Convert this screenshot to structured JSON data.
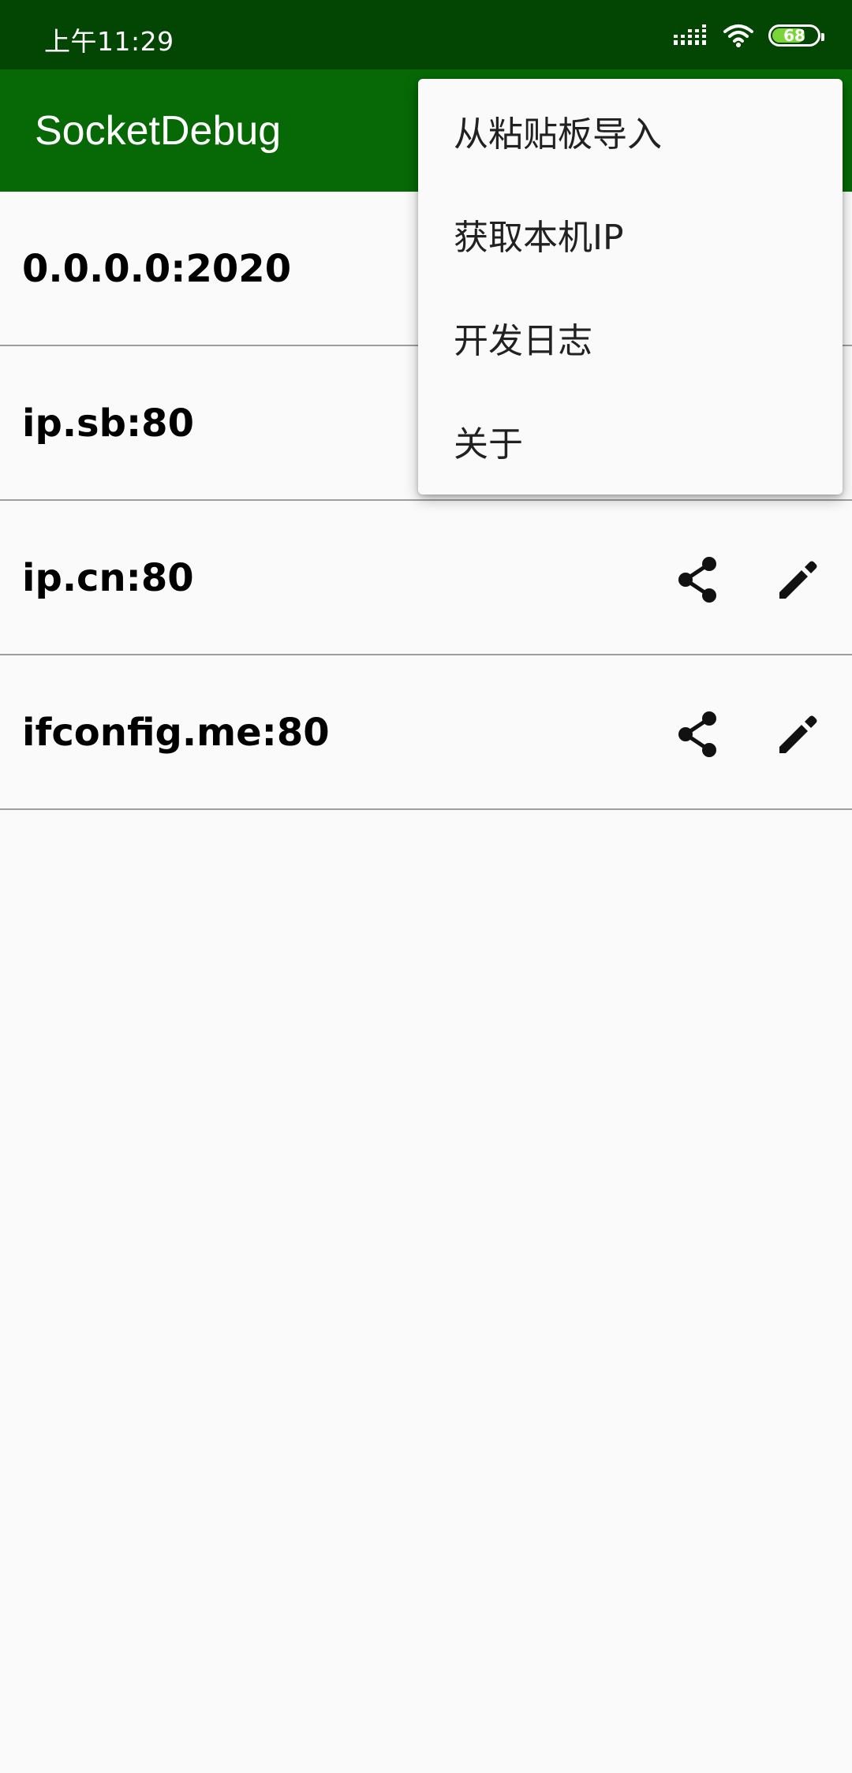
{
  "status_bar": {
    "time": "上午11:29",
    "battery_level": "68",
    "battery_fraction": 0.68
  },
  "app_bar": {
    "title": "SocketDebug"
  },
  "list": {
    "items": [
      {
        "label": "0.0.0.0:2020"
      },
      {
        "label": "ip.sb:80"
      },
      {
        "label": "ip.cn:80",
        "actions": [
          "share-icon",
          "edit-icon"
        ]
      },
      {
        "label": "ifconfig.me:80",
        "actions": [
          "share-icon",
          "edit-icon"
        ]
      }
    ]
  },
  "overflow_menu": {
    "items": [
      {
        "label": "从粘贴板导入"
      },
      {
        "label": "获取本机IP"
      },
      {
        "label": "开发日志"
      },
      {
        "label": "关于"
      }
    ]
  },
  "colors": {
    "status_bar": "#034503",
    "app_bar": "#066906",
    "background": "#fafafa",
    "battery_accent": "#7cd43a"
  }
}
